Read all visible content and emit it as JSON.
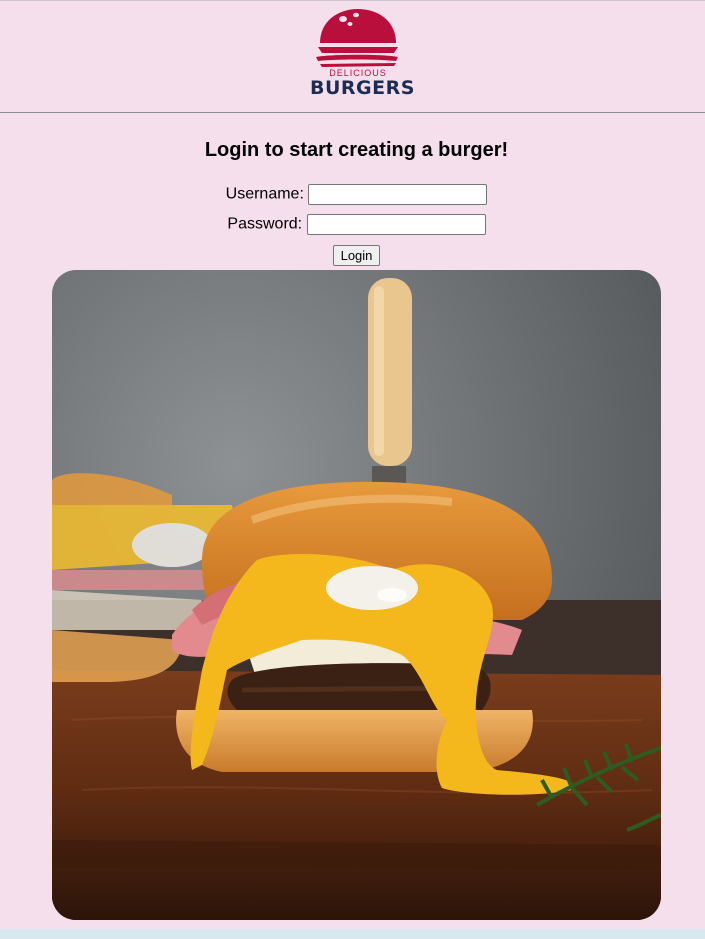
{
  "logo": {
    "small_text": "DELICIOUS",
    "big_text": "BURGERS",
    "icon": "burger-logo-icon",
    "colors": {
      "red": "#b80f3c",
      "navy": "#1b2d52"
    }
  },
  "login": {
    "heading": "Login to start creating a burger!",
    "username_label": "Username:",
    "username_value": "",
    "password_label": "Password:",
    "password_value": "",
    "submit_label": "Login"
  },
  "hero_image": {
    "alt": "Burger with ham, melted cheese and runny egg yolk on a wooden board"
  },
  "colors": {
    "page_background": "#f6dfec",
    "footer_strip": "#d9e8ee"
  }
}
